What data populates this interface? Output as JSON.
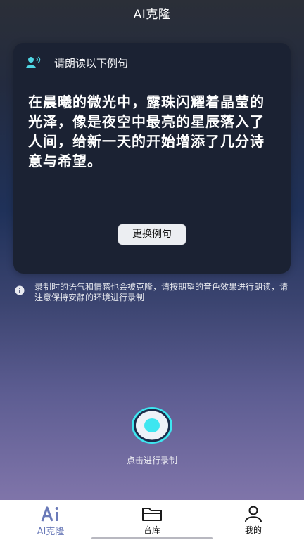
{
  "header": {
    "title": "AI克隆"
  },
  "card": {
    "header_text": "请朗读以下例句",
    "sentence": "在晨曦的微光中，露珠闪耀着晶莹的光泽，像是夜空中最亮的星辰落入了人间，给新一天的开始增添了几分诗意与希望。",
    "change_button": "更换例句"
  },
  "notice": {
    "text": "录制时的语气和情感也会被克隆，请按期望的音色效果进行朗读，请注意保持安静的环境进行录制"
  },
  "record": {
    "label": "点击进行录制"
  },
  "tabs": [
    {
      "label": "AI克隆",
      "icon": "ai-logo-icon",
      "active": true
    },
    {
      "label": "音库",
      "icon": "folder-icon",
      "active": false
    },
    {
      "label": "我的",
      "icon": "user-icon",
      "active": false
    }
  ],
  "colors": {
    "accent": "#6a7ab8",
    "record_cyan": "#3ee6f0",
    "card_bg": "#1b2233"
  }
}
